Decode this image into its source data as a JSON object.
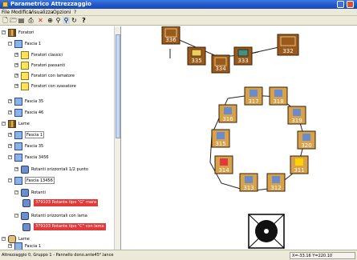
{
  "window": {
    "title": "Parametrico Attrezzaggio"
  },
  "menu": {
    "items": [
      "File",
      "Modifica",
      "Visualizza",
      "Opzioni",
      "?"
    ]
  },
  "toolbar": {
    "buttons": [
      "new-icon",
      "open-icon",
      "save-icon",
      "print-icon",
      "delete-icon",
      "zoom-fit-icon",
      "zoom-in-icon",
      "zoom-window-icon",
      "refresh-icon",
      "help-icon"
    ]
  },
  "tree": {
    "items": [
      {
        "label": "Foratori",
        "icon": "bar"
      },
      {
        "label": "Fascia 1",
        "icon": "frame"
      },
      {
        "label": "Foratori classici",
        "icon": "yellow"
      },
      {
        "label": "Foratori passanti",
        "icon": "yellow"
      },
      {
        "label": "Foratori con lamatore",
        "icon": "yellow"
      },
      {
        "label": "Foratori con svasatore",
        "icon": "yellow"
      },
      {
        "label": "Fascia 35",
        "icon": "frame"
      },
      {
        "label": "Fascia 46",
        "icon": "frame"
      },
      {
        "label": "Lame",
        "icon": "bar"
      },
      {
        "label": "Fascia 1",
        "icon": "frame"
      },
      {
        "label": "Fascia 35",
        "icon": "frame"
      },
      {
        "label": "Fascia 3456",
        "icon": "frame"
      },
      {
        "label": "Rotanti orizzontali 1/2 punto",
        "icon": "tool"
      },
      {
        "label": "Fascia 13456",
        "icon": "frame"
      },
      {
        "label": "Rotanti",
        "icon": "tool"
      },
      {
        "label": "Rotanti orizzontali con lama",
        "icon": "tool"
      },
      {
        "label": "Lame",
        "icon": "drill"
      },
      {
        "label": "Fascia 1",
        "icon": "frame"
      }
    ],
    "highlighted": [
      "379103 Rotante tipo \"G\" mara",
      "379103 Rotante tipo \"C\" con lama"
    ]
  },
  "canvas": {
    "stations": [
      "336",
      "335",
      "334",
      "333",
      "332",
      "317",
      "318",
      "316",
      "319",
      "315",
      "320",
      "314",
      "311",
      "313",
      "312"
    ]
  },
  "status": {
    "left": "Attrezzaggio 0, Gruppo 1 - Pannello dono.ante45°.lance",
    "right": "X=-33.16 Y=220.10"
  },
  "colors": {
    "station_fill": "#9a5a1c",
    "station_border": "#3a1c00",
    "highlight": "#e03a3a",
    "accent": "#ffd200"
  }
}
